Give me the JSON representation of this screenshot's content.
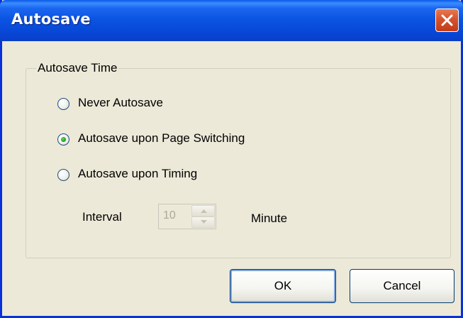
{
  "window": {
    "title": "Autosave",
    "close_icon": "close-x-icon"
  },
  "group": {
    "label": "Autosave Time",
    "options": [
      {
        "label": "Never Autosave",
        "checked": false
      },
      {
        "label": "Autosave upon Page Switching",
        "checked": true
      },
      {
        "label": "Autosave upon Timing",
        "checked": false
      }
    ]
  },
  "interval": {
    "label": "Interval",
    "value": "10",
    "unit": "Minute",
    "enabled": false
  },
  "buttons": {
    "ok": "OK",
    "cancel": "Cancel"
  },
  "colors": {
    "titlebar": "#0a52e0",
    "close_button": "#d65330",
    "radio_selected_dot": "#21a121",
    "dialog_background": "#ece9d8"
  }
}
